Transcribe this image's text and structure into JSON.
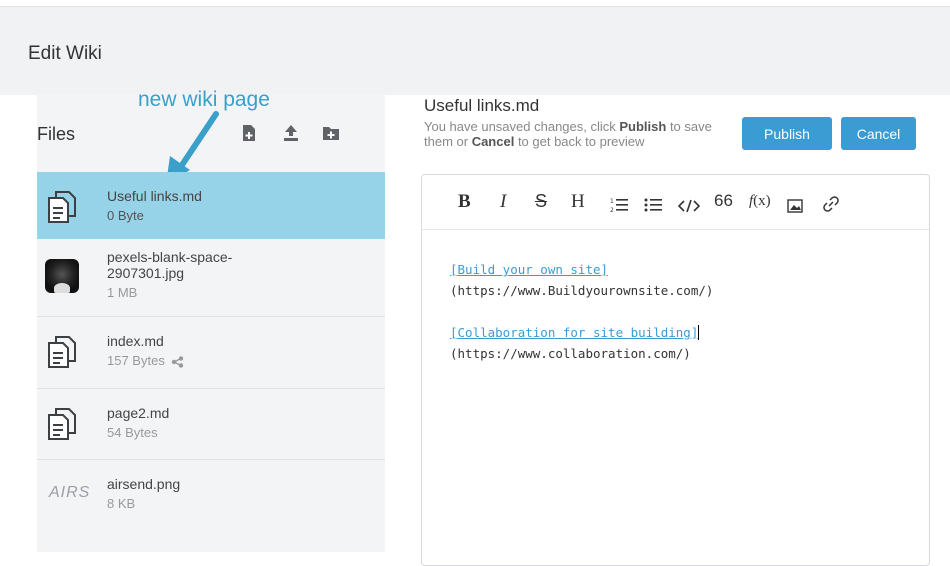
{
  "header": {
    "title": "Edit Wiki"
  },
  "annotation": {
    "text": "new wiki page",
    "color": "#3aa0c9"
  },
  "files": {
    "label": "Files",
    "toolbar_icons": [
      "new-file-icon",
      "upload-icon",
      "new-folder-icon"
    ],
    "items": [
      {
        "name": "Useful links.md",
        "size": "0 Byte",
        "icon": "document-icon",
        "selected": true
      },
      {
        "name": "pexels-blank-space-2907301.jpg",
        "size": "1 MB",
        "icon": "image-thumbnail"
      },
      {
        "name": "index.md",
        "size": "157 Bytes",
        "icon": "document-icon",
        "shared": true
      },
      {
        "name": "page2.md",
        "size": "54 Bytes",
        "icon": "document-icon"
      },
      {
        "name": "airsend.png",
        "size": "8 KB",
        "icon": "image-thumbnail",
        "thumb_text": "AIRS"
      }
    ]
  },
  "editor": {
    "doc_title": "Useful links.md",
    "unsaved_parts": [
      "You have unsaved changes, click ",
      "Publish",
      " to save them or ",
      "Cancel",
      " to get back to preview"
    ],
    "publish_label": "Publish",
    "cancel_label": "Cancel",
    "toolbar": [
      {
        "name": "bold-button",
        "glyph": "B"
      },
      {
        "name": "italic-button",
        "glyph": "I"
      },
      {
        "name": "strikethrough-button",
        "glyph": "S"
      },
      {
        "name": "heading-button",
        "glyph": "H"
      },
      {
        "name": "ordered-list-button",
        "glyph": "ol"
      },
      {
        "name": "bullet-list-button",
        "glyph": "ul"
      },
      {
        "name": "code-button",
        "glyph": "</>"
      },
      {
        "name": "quote-button",
        "glyph": "66"
      },
      {
        "name": "formula-button",
        "glyph": "f(x)"
      },
      {
        "name": "image-button",
        "glyph": "img"
      },
      {
        "name": "link-button",
        "glyph": "link"
      }
    ],
    "lines": [
      {
        "text": "[Build your own site]",
        "link": true
      },
      {
        "text": "(https://www.Buildyourownsite.com/)",
        "link": false
      },
      {
        "text": "",
        "link": false
      },
      {
        "text": "[Collaboration for site building]",
        "link": true,
        "caret": true
      },
      {
        "text": "(https://www.collaboration.com/)",
        "link": false
      }
    ]
  },
  "colors": {
    "accent": "#3b9cd3",
    "selected_row": "#96d3e9",
    "pane_bg": "#f3f4f6",
    "header_bg": "#f1f2f3"
  }
}
